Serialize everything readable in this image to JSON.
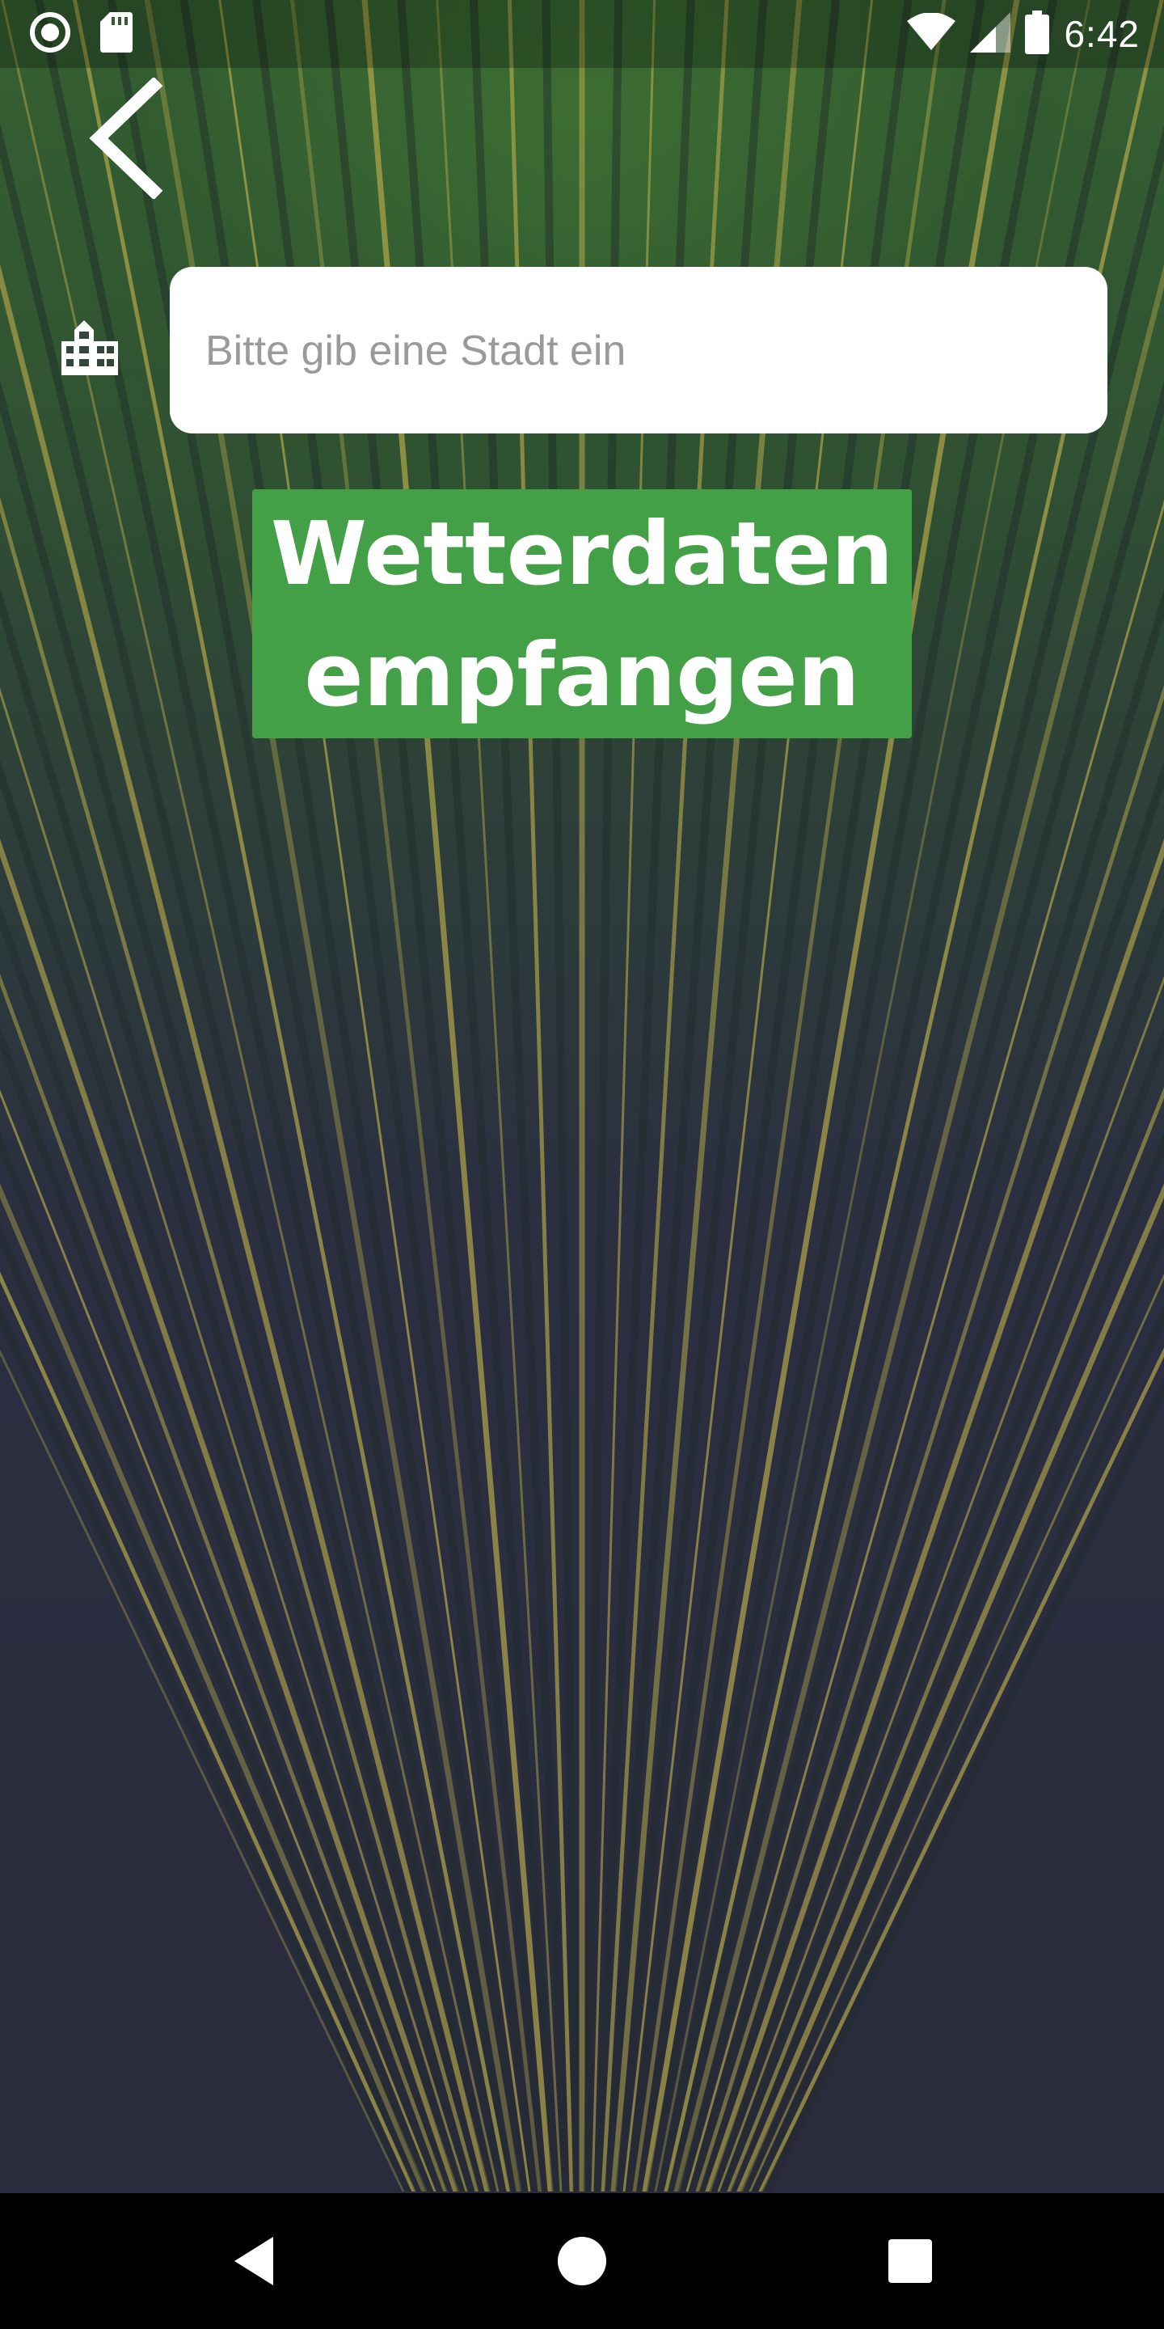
{
  "status_bar": {
    "time": "6:42",
    "icons": [
      "record-icon",
      "sd-card-icon",
      "wifi-icon",
      "cell-signal-icon",
      "battery-icon"
    ]
  },
  "toolbar": {
    "back_icon": "chevron-left-icon"
  },
  "search": {
    "icon": "city-icon",
    "placeholder": "Bitte gib eine Stadt ein",
    "value": ""
  },
  "action": {
    "label": "Wetterdaten empfangen",
    "background": "#44a047"
  },
  "nav_bar": {
    "icons": [
      "back-triangle-icon",
      "home-circle-icon",
      "recents-square-icon"
    ]
  },
  "colors": {
    "background_top": "#3d6a35",
    "background_bottom": "#2a2b3d",
    "leaf_stripe": "#b5a84a"
  }
}
